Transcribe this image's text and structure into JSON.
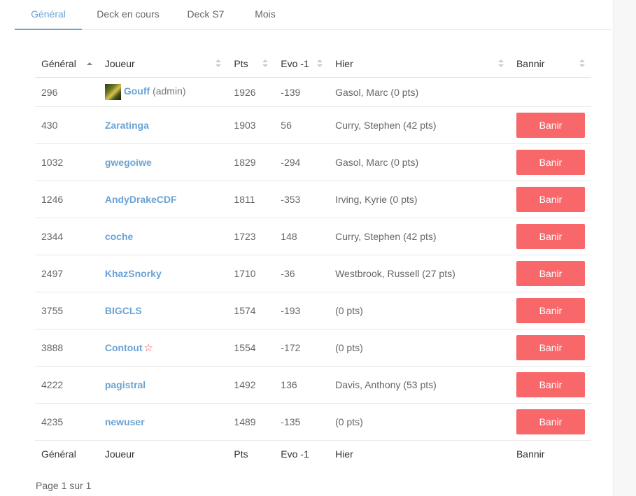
{
  "tabs": [
    {
      "label": "Général",
      "active": true
    },
    {
      "label": "Deck en cours",
      "active": false
    },
    {
      "label": "Deck S7",
      "active": false
    },
    {
      "label": "Mois",
      "active": false
    }
  ],
  "table": {
    "columns": [
      "Général",
      "Joueur",
      "Pts",
      "Evo -1",
      "Hier",
      "Bannir"
    ],
    "sorted_column": "Général",
    "sort_direction": "ascending",
    "ban_label": "Banir",
    "rows": [
      {
        "rank": "296",
        "player": "Gouff",
        "player_suffix": "(admin)",
        "has_avatar": true,
        "pts": "1926",
        "evo": "-139",
        "hier": "Gasol, Marc (0 pts)",
        "can_ban": false
      },
      {
        "rank": "430",
        "player": "Zaratinga",
        "pts": "1903",
        "evo": "56",
        "hier": "Curry, Stephen (42 pts)",
        "can_ban": true
      },
      {
        "rank": "1032",
        "player": "gwegoiwe",
        "pts": "1829",
        "evo": "-294",
        "hier": "Gasol, Marc (0 pts)",
        "can_ban": true
      },
      {
        "rank": "1246",
        "player": "AndyDrakeCDF",
        "pts": "1811",
        "evo": "-353",
        "hier": "Irving, Kyrie (0 pts)",
        "can_ban": true
      },
      {
        "rank": "2344",
        "player": "coche",
        "pts": "1723",
        "evo": "148",
        "hier": "Curry, Stephen (42 pts)",
        "can_ban": true
      },
      {
        "rank": "2497",
        "player": "KhazSnorky",
        "pts": "1710",
        "evo": "-36",
        "hier": "Westbrook, Russell (27 pts)",
        "can_ban": true
      },
      {
        "rank": "3755",
        "player": "BIGCLS",
        "pts": "1574",
        "evo": "-193",
        "hier": "(0 pts)",
        "can_ban": true
      },
      {
        "rank": "3888",
        "player": "Contout",
        "star": "☆",
        "pts": "1554",
        "evo": "-172",
        "hier": "(0 pts)",
        "can_ban": true
      },
      {
        "rank": "4222",
        "player": "pagistral",
        "pts": "1492",
        "evo": "136",
        "hier": "Davis, Anthony (53 pts)",
        "can_ban": true
      },
      {
        "rank": "4235",
        "player": "newuser",
        "pts": "1489",
        "evo": "-135",
        "hier": "(0 pts)",
        "can_ban": true
      }
    ]
  },
  "pagination": {
    "text": "Page 1 sur 1"
  },
  "colors": {
    "accent": "#6aa3d5",
    "ban_button": "#f8686b",
    "star": "#e8555a"
  }
}
